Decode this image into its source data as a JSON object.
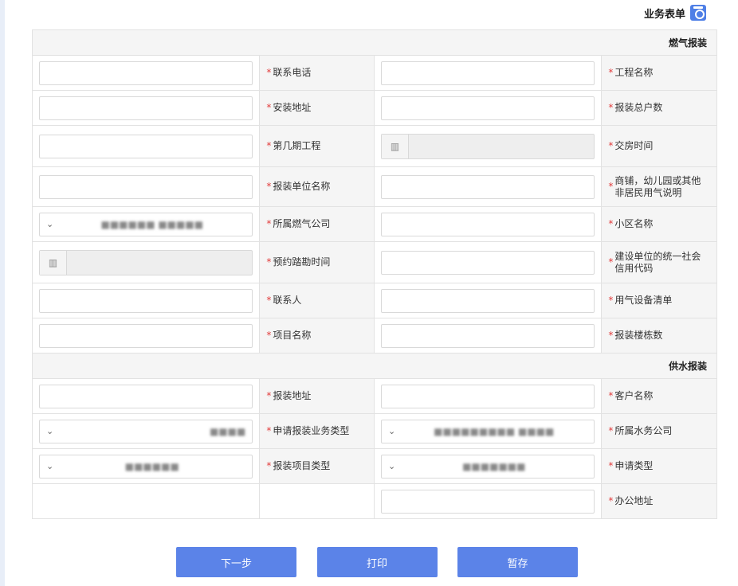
{
  "page": {
    "title": "业务表单",
    "title_icon": "form-badge-icon",
    "accent": "#5b83e8"
  },
  "sections": {
    "gas": {
      "header": "燃气报装",
      "rows": [
        {
          "left_label": "联系电话",
          "right_label": "工程名称"
        },
        {
          "left_label": "安装地址",
          "right_label": "报装总户数"
        },
        {
          "left_label": "第几期工程",
          "right_label": "交房时间"
        },
        {
          "left_label": "报装单位名称",
          "right_label": "商铺，幼儿园或其他非居民用气说明"
        },
        {
          "left_label": "所属燃气公司",
          "left_value": "■■■■■■ ■■■■■",
          "right_label": "小区名称"
        },
        {
          "left_label": "预约踏勘时间",
          "right_label": "建设单位的统一社会信用代码"
        },
        {
          "left_label": "联系人",
          "right_label": "用气设备清单"
        },
        {
          "left_label": "项目名称",
          "right_label": "报装楼栋数"
        }
      ]
    },
    "water": {
      "header": "供水报装",
      "rows": [
        {
          "left_label": "报装地址",
          "right_label": "客户名称"
        },
        {
          "left_label": "申请报装业务类型",
          "left_value": "■■■■",
          "right_label": "所属水务公司",
          "right_value": "■■■■■■■■■ ■■■■"
        },
        {
          "left_label": "报装项目类型",
          "left_value": "■■■■■■",
          "right_label": "申请类型",
          "right_value": "■■■■■■■"
        },
        {
          "right_label": "办公地址"
        }
      ]
    }
  },
  "buttons": {
    "next": "下一步",
    "print": "打印",
    "save": "暂存"
  }
}
